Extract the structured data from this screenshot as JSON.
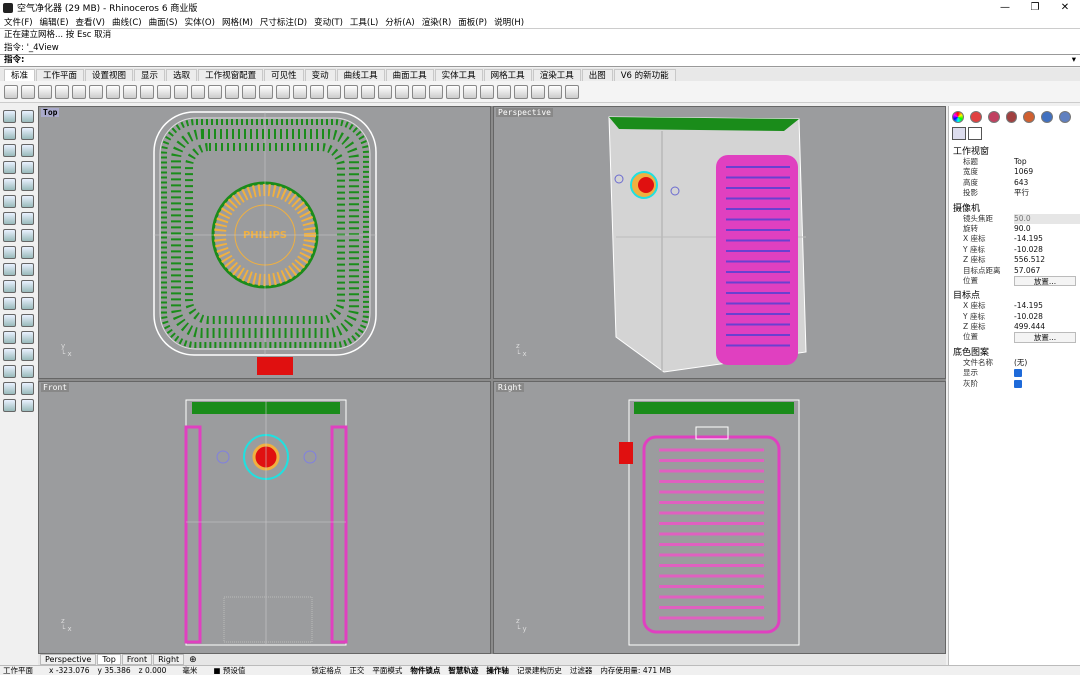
{
  "window": {
    "title": "空气净化器 (29 MB) - Rhinoceros 6 商业版",
    "min": "—",
    "max": "❐",
    "close": "✕"
  },
  "menu": [
    "文件(F)",
    "编辑(E)",
    "查看(V)",
    "曲线(C)",
    "曲面(S)",
    "实体(O)",
    "网格(M)",
    "尺寸标注(D)",
    "变动(T)",
    "工具(L)",
    "分析(A)",
    "渲染(R)",
    "面板(P)",
    "说明(H)"
  ],
  "command_history": [
    "正在建立网格... 按 Esc 取消",
    "指令: '_4View"
  ],
  "command_prompt": "指令:",
  "toolbar_tabs": [
    "标准",
    "工作平面",
    "设置视图",
    "显示",
    "选取",
    "工作视窗配置",
    "可见性",
    "变动",
    "曲线工具",
    "曲面工具",
    "实体工具",
    "网格工具",
    "渲染工具",
    "出图",
    "V6 的新功能"
  ],
  "toolbar_icon_count": 34,
  "left_tool_count": 36,
  "viewports": {
    "top": {
      "label": "Top"
    },
    "perspective": {
      "label": "Perspective"
    },
    "front": {
      "label": "Front"
    },
    "right": {
      "label": "Right"
    },
    "logo_text": "PHILIPS"
  },
  "viewport_tabs": [
    "Perspective",
    "Top",
    "Front",
    "Right"
  ],
  "viewport_tab_add": "⊕",
  "properties": {
    "section_viewport": "工作视窗",
    "viewport_rows": [
      {
        "k": "标题",
        "v": "Top"
      },
      {
        "k": "宽度",
        "v": "1069"
      },
      {
        "k": "高度",
        "v": "643"
      },
      {
        "k": "投影",
        "v": "平行"
      }
    ],
    "section_camera": "摄像机",
    "camera_rows": [
      {
        "k": "镜头焦距",
        "v": "50.0"
      },
      {
        "k": "旋转",
        "v": "90.0"
      },
      {
        "k": "X 座标",
        "v": "-14.195"
      },
      {
        "k": "Y 座标",
        "v": "-10.028"
      },
      {
        "k": "Z 座标",
        "v": "556.512"
      },
      {
        "k": "目标点距离",
        "v": "57.067"
      },
      {
        "k": "位置",
        "v": "放置..."
      }
    ],
    "section_target": "目标点",
    "target_rows": [
      {
        "k": "X 座标",
        "v": "-14.195"
      },
      {
        "k": "Y 座标",
        "v": "-10.028"
      },
      {
        "k": "Z 座标",
        "v": "499.444"
      },
      {
        "k": "位置",
        "v": "放置..."
      }
    ],
    "section_wallpaper": "底色图案",
    "wallpaper_rows": [
      {
        "k": "文件名称",
        "v": "(无)"
      },
      {
        "k": "显示",
        "v": ""
      },
      {
        "k": "灰阶",
        "v": ""
      }
    ]
  },
  "status": {
    "cplane": "工作平面",
    "x": "x -323.076",
    "y": "y 35.386",
    "z": "z 0.000",
    "unit": "毫米",
    "layer": "预设值",
    "items": [
      "锁定格点",
      "正交",
      "平面模式",
      "物件锁点",
      "智慧轨迹",
      "操作轴",
      "记录建构历史",
      "过滤器",
      "内存使用量: 471 MB"
    ]
  },
  "colors": {
    "accent": "#1e6ad9",
    "viewport_bg": "#9b9c9e",
    "green": "#1a8c1a",
    "magenta": "#e040c0",
    "orange": "#f0b040",
    "red": "#e01010",
    "cyan": "#20e0e0"
  }
}
